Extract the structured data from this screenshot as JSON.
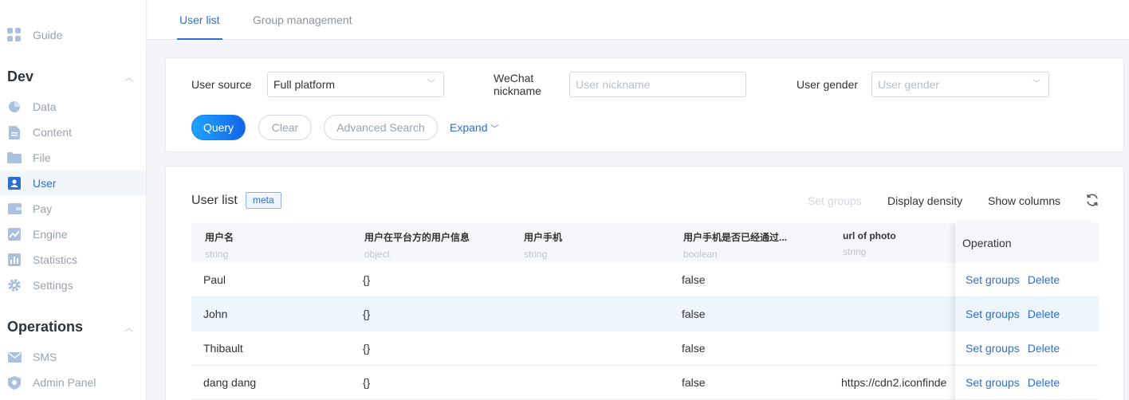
{
  "sidebar": {
    "guide": {
      "label": "Guide",
      "icon": "grid-icon"
    },
    "dev_group": {
      "title": "Dev"
    },
    "dev_items": [
      {
        "label": "Data",
        "icon": "pie-chart-icon"
      },
      {
        "label": "Content",
        "icon": "document-icon"
      },
      {
        "label": "File",
        "icon": "folder-icon"
      },
      {
        "label": "User",
        "icon": "user-card-icon",
        "active": true
      },
      {
        "label": "Pay",
        "icon": "wallet-icon"
      },
      {
        "label": "Engine",
        "icon": "trend-icon"
      },
      {
        "label": "Statistics",
        "icon": "bar-chart-icon"
      },
      {
        "label": "Settings",
        "icon": "gear-icon"
      }
    ],
    "ops_group": {
      "title": "Operations"
    },
    "ops_items": [
      {
        "label": "SMS",
        "icon": "mail-icon"
      },
      {
        "label": "Admin Panel",
        "icon": "shield-icon"
      }
    ]
  },
  "tabs": {
    "user_list": "User list",
    "group_management": "Group management"
  },
  "filters": {
    "user_source_label": "User source",
    "user_source_value": "Full platform",
    "wechat_label_line1": "WeChat",
    "wechat_label_line2": "nickname",
    "nickname_placeholder": "User nickname",
    "gender_label": "User gender",
    "gender_placeholder": "User gender",
    "query": "Query",
    "clear": "Clear",
    "advanced": "Advanced Search",
    "expand": "Expand"
  },
  "list": {
    "title": "User list",
    "badge": "meta",
    "set_groups": "Set groups",
    "display_density": "Display density",
    "show_columns": "Show columns",
    "columns": [
      {
        "name": "用户名",
        "type": "string"
      },
      {
        "name": "用户在平台方的用户信息",
        "type": "object"
      },
      {
        "name": "用户手机",
        "type": "string"
      },
      {
        "name": "用户手机是否已经通过...",
        "type": "boolean"
      },
      {
        "name": "url of photo",
        "type": "string"
      }
    ],
    "operation_header": "Operation",
    "rows": [
      {
        "name": "Paul",
        "info": "{}",
        "phone": "",
        "verified": "false",
        "photo": ""
      },
      {
        "name": "John",
        "info": "{}",
        "phone": "",
        "verified": "false",
        "photo": ""
      },
      {
        "name": "Thibault",
        "info": "{}",
        "phone": "",
        "verified": "false",
        "photo": ""
      },
      {
        "name": "dang dang",
        "info": "{}",
        "phone": "",
        "verified": "false",
        "photo": "https://cdn2.iconfinde"
      }
    ],
    "op_set_groups": "Set groups",
    "op_delete": "Delete"
  },
  "colors": {
    "accent": "#2b6fd6",
    "highlight_row": "#eef5fd"
  }
}
